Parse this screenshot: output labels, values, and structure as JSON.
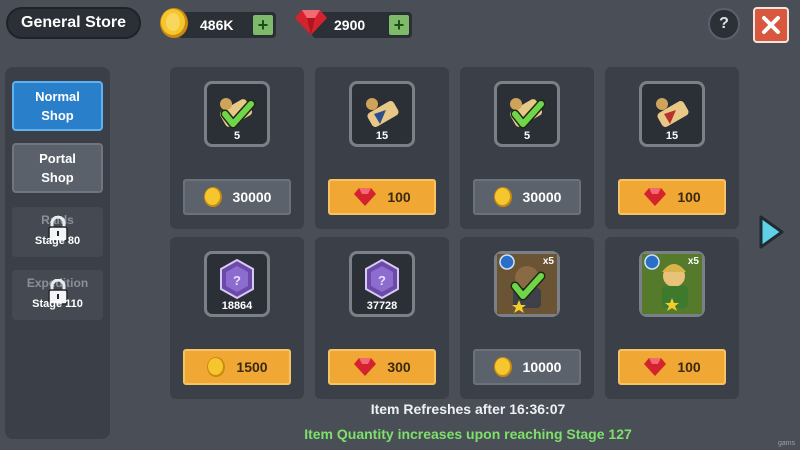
{
  "header": {
    "title": "General Store",
    "gold_amount": "486K",
    "ruby_amount": "2900",
    "plus_symbol": "+",
    "help_symbol": "?"
  },
  "sidebar": {
    "items": [
      {
        "label_line1": "Normal",
        "label_line2": "Shop",
        "state": "active"
      },
      {
        "label_line1": "Portal",
        "label_line2": "Shop",
        "state": "normal"
      },
      {
        "ghost_label": "Raids",
        "stage": "Stage 80",
        "state": "locked"
      },
      {
        "ghost_label": "Expedition",
        "stage": "Stage 110",
        "state": "locked"
      }
    ]
  },
  "shop": {
    "items": [
      {
        "icon": "scroll-gold-icon",
        "quantity": "5",
        "price": "30000",
        "currency": "gold",
        "purchased": true
      },
      {
        "icon": "scroll-blue-icon",
        "quantity": "15",
        "price": "100",
        "currency": "ruby",
        "purchased": false
      },
      {
        "icon": "scroll-gold-icon",
        "quantity": "5",
        "price": "30000",
        "currency": "gold",
        "purchased": true
      },
      {
        "icon": "scroll-red-icon",
        "quantity": "15",
        "price": "100",
        "currency": "ruby",
        "purchased": false
      },
      {
        "icon": "purple-gem-icon",
        "quantity": "18864",
        "price": "1500",
        "currency": "gold",
        "purchased": false
      },
      {
        "icon": "purple-gem-icon",
        "quantity": "37728",
        "price": "300",
        "currency": "ruby",
        "purchased": false
      },
      {
        "icon": "hero-portrait-icon",
        "quantity": "x5",
        "price": "10000",
        "currency": "gold",
        "purchased": true
      },
      {
        "icon": "hero-portrait-icon",
        "quantity": "x5",
        "price": "100",
        "currency": "ruby",
        "purchased": false
      }
    ]
  },
  "footer": {
    "refresh_text": "Item Refreshes after 16:36:07",
    "quantity_text": "Item Quantity increases upon reaching Stage 127",
    "watermark": "gams"
  },
  "colors": {
    "gold": "#f2c230",
    "ruby": "#e0303a",
    "accent_green": "#7ee06a",
    "active_tab": "#2a7fca",
    "price_button": "#f0a733"
  }
}
